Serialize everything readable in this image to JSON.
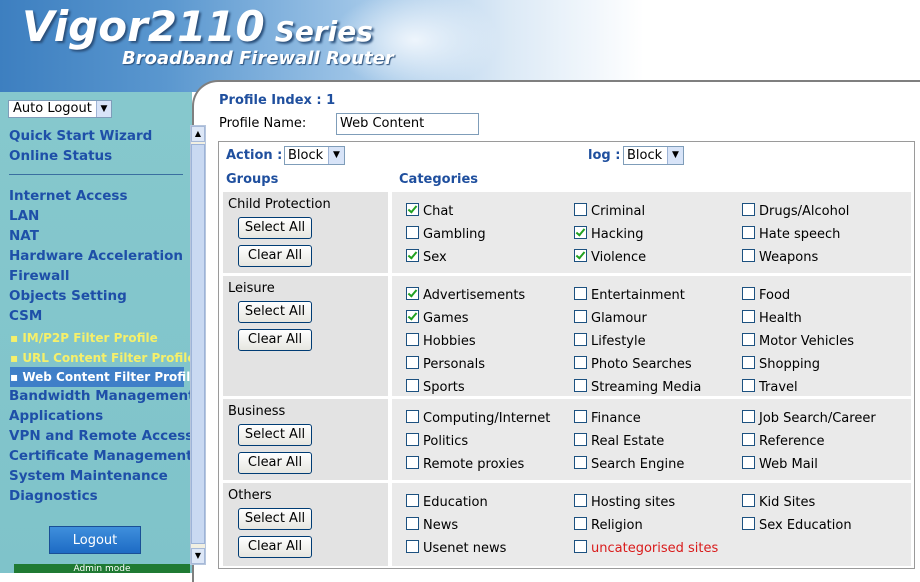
{
  "banner": {
    "brand": "Vigor2110",
    "series": "Series",
    "tagline": "Broadband Firewall Router"
  },
  "sidebar": {
    "auto_logout": "Auto Logout",
    "top_items": [
      "Quick Start Wizard",
      "Online Status"
    ],
    "items": [
      "Internet Access",
      "LAN",
      "NAT",
      "Hardware Acceleration",
      "Firewall",
      "Objects Setting",
      "CSM"
    ],
    "sub_items": [
      "IM/P2P Filter Profile",
      "URL Content Filter Profile",
      "Web Content Filter Profile"
    ],
    "bottom_items": [
      "Bandwidth Management",
      "Applications",
      "VPN and Remote Access",
      "Certificate Management",
      "System Maintenance",
      "Diagnostics"
    ],
    "logout": "Logout",
    "admin_mode": "Admin mode"
  },
  "content": {
    "profile_index": "Profile Index : 1",
    "profile_name_label": "Profile Name:",
    "profile_name_value": "Web Content",
    "action_label": "Action :",
    "action_value": "Block",
    "log_label": "log :",
    "log_value": "Block",
    "groups_header": "Groups",
    "categories_header": "Categories",
    "select_all": "Select All",
    "clear_all": "Clear All",
    "groups": [
      {
        "name": "Child Protection",
        "categories": [
          {
            "label": "Chat",
            "checked": true
          },
          {
            "label": "Criminal",
            "checked": false
          },
          {
            "label": "Drugs/Alcohol",
            "checked": false
          },
          {
            "label": "Gambling",
            "checked": false
          },
          {
            "label": "Hacking",
            "checked": true
          },
          {
            "label": "Hate speech",
            "checked": false
          },
          {
            "label": "Sex",
            "checked": true
          },
          {
            "label": "Violence",
            "checked": true
          },
          {
            "label": "Weapons",
            "checked": false
          }
        ]
      },
      {
        "name": "Leisure",
        "categories": [
          {
            "label": "Advertisements",
            "checked": true
          },
          {
            "label": "Entertainment",
            "checked": false
          },
          {
            "label": "Food",
            "checked": false
          },
          {
            "label": "Games",
            "checked": true
          },
          {
            "label": "Glamour",
            "checked": false
          },
          {
            "label": "Health",
            "checked": false
          },
          {
            "label": "Hobbies",
            "checked": false
          },
          {
            "label": "Lifestyle",
            "checked": false
          },
          {
            "label": "Motor Vehicles",
            "checked": false
          },
          {
            "label": "Personals",
            "checked": false
          },
          {
            "label": "Photo Searches",
            "checked": false
          },
          {
            "label": "Shopping",
            "checked": false
          },
          {
            "label": "Sports",
            "checked": false
          },
          {
            "label": "Streaming Media",
            "checked": false
          },
          {
            "label": "Travel",
            "checked": false
          }
        ]
      },
      {
        "name": "Business",
        "categories": [
          {
            "label": "Computing/Internet",
            "checked": false
          },
          {
            "label": "Finance",
            "checked": false
          },
          {
            "label": "Job Search/Career",
            "checked": false
          },
          {
            "label": "Politics",
            "checked": false
          },
          {
            "label": "Real Estate",
            "checked": false
          },
          {
            "label": "Reference",
            "checked": false
          },
          {
            "label": "Remote proxies",
            "checked": false
          },
          {
            "label": "Search Engine",
            "checked": false
          },
          {
            "label": "Web Mail",
            "checked": false
          }
        ]
      },
      {
        "name": "Others",
        "categories": [
          {
            "label": "Education",
            "checked": false
          },
          {
            "label": "Hosting sites",
            "checked": false
          },
          {
            "label": "Kid Sites",
            "checked": false
          },
          {
            "label": "News",
            "checked": false
          },
          {
            "label": "Religion",
            "checked": false
          },
          {
            "label": "Sex Education",
            "checked": false
          },
          {
            "label": "Usenet news",
            "checked": false
          },
          {
            "label": "uncategorised sites",
            "checked": false,
            "highlight": "#d91b1b"
          }
        ]
      }
    ]
  }
}
